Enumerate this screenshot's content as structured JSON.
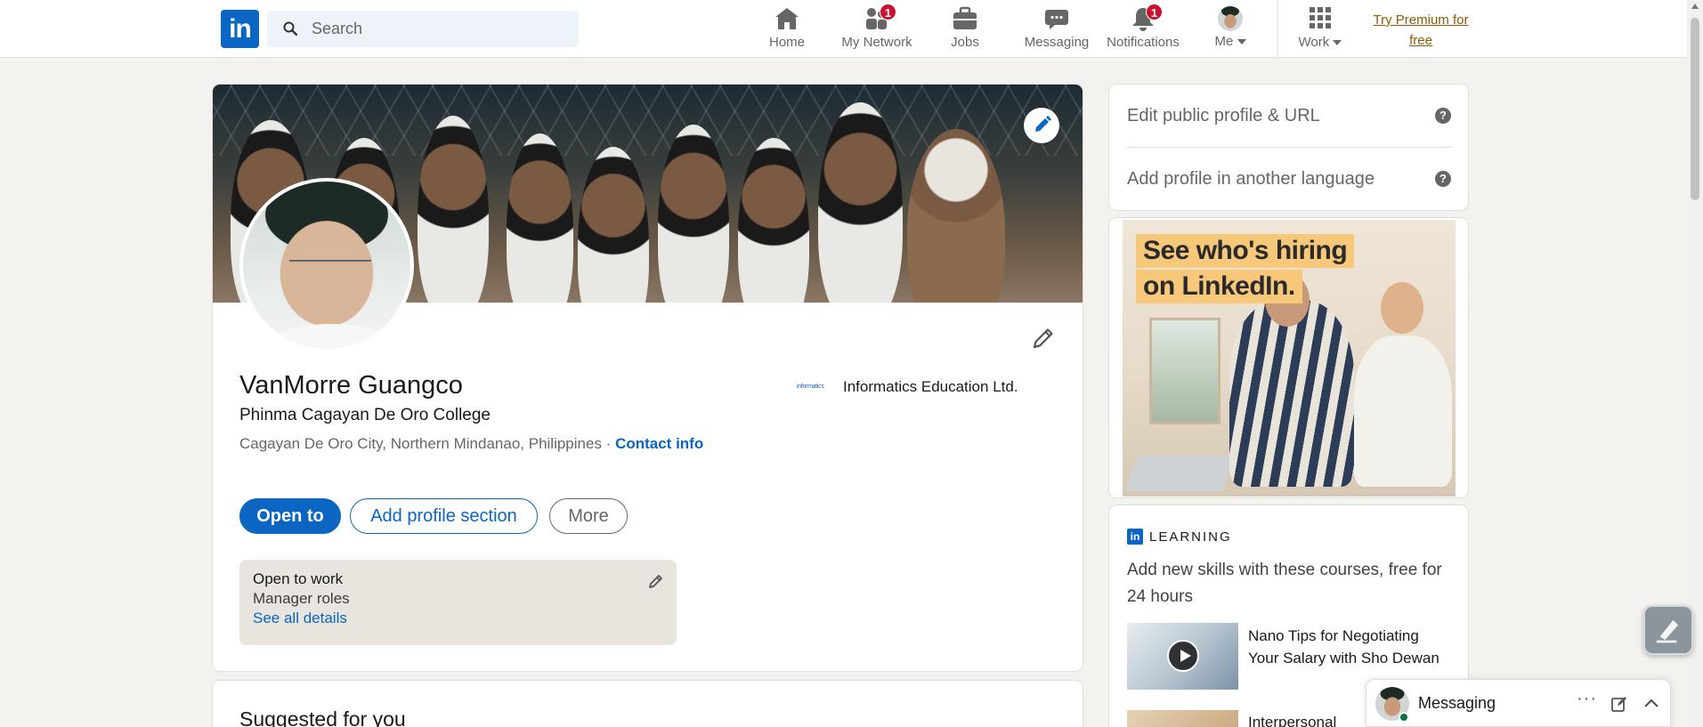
{
  "nav": {
    "logo_text": "in",
    "search_placeholder": "Search",
    "items": [
      {
        "label": "Home",
        "icon": "home-icon"
      },
      {
        "label": "My Network",
        "icon": "network-icon",
        "badge": "1"
      },
      {
        "label": "Jobs",
        "icon": "briefcase-icon"
      },
      {
        "label": "Messaging",
        "icon": "chat-icon"
      },
      {
        "label": "Notifications",
        "icon": "bell-icon",
        "badge": "1"
      },
      {
        "label": "Me",
        "icon": "avatar"
      },
      {
        "label": "Work",
        "icon": "grid-icon"
      }
    ],
    "premium_line1": "Try Premium for",
    "premium_line2": "free",
    "premium_color": "#915907",
    "badge_color": "#cb112d"
  },
  "profile": {
    "name": "VanMorre Guangco",
    "headline": "Phinma Cagayan De Oro College",
    "location": "Cagayan De Oro City, Northern Mindanao, Philippines",
    "separator": " · ",
    "contact_info": "Contact info",
    "company_logo_text": "informatics",
    "company": "Informatics Education Ltd.",
    "buttons": {
      "open_to": "Open to",
      "add_section": "Add profile section",
      "more": "More"
    },
    "open_to_work": {
      "title": "Open to work",
      "roles": "Manager roles",
      "link": "See all details"
    },
    "accent_color": "#0a66c2"
  },
  "suggested": {
    "title": "Suggested for you"
  },
  "sidebar": {
    "edit_public_profile": "Edit public profile & URL",
    "add_language": "Add profile in another language",
    "help_glyph": "?",
    "ad": {
      "line1": "See who's hiring",
      "line2": "on LinkedIn."
    },
    "learning": {
      "logo_text": "in",
      "label": "LEARNING",
      "description": "Add new skills with these courses, free for 24 hours",
      "courses": [
        {
          "title": "Nano Tips for Negotiating Your Salary with Sho Dewan"
        },
        {
          "title": "Interpersonal"
        }
      ]
    }
  },
  "messaging_bar": {
    "label": "Messaging",
    "more_glyph": "···"
  }
}
